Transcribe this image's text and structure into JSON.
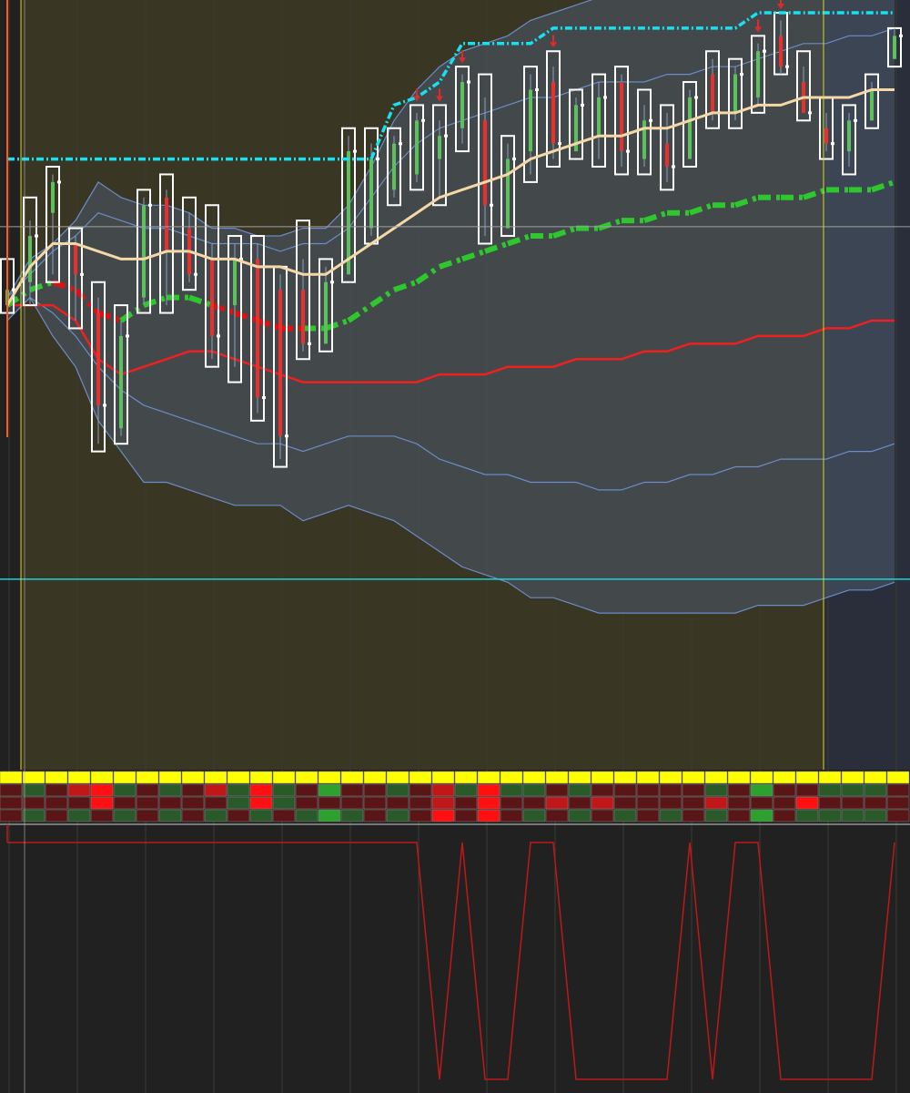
{
  "colors": {
    "background": "#212121",
    "session_shade": "#3a3624",
    "future_shade": "#2a2e3a",
    "band_fill": "#4a5a6a",
    "band_line": "#6a8cc8",
    "candle_up": "#5cc05c",
    "candle_down": "#e83030",
    "range_box": "#ffffff",
    "cyan": "#19e0f0",
    "tan": "#f5d8a8",
    "trend_green": "#2ec82e",
    "trend_red": "#e01010",
    "red_line": "#ee2020",
    "session_line": "#d8d820",
    "orange_line": "#ff5a1a",
    "price_line": "#a0a0a0",
    "support_line": "#20d0d8",
    "arrow": "#e02a2a",
    "osc_line": "#c01818",
    "heat_yellow": "#ffff00",
    "heat_bright_red": "#ff1010",
    "heat_red": "#c01818",
    "heat_dark_red": "#5a1616",
    "heat_green": "#2a5a2a",
    "heat_bright_green": "#2ea02e"
  },
  "chart_data": {
    "type": "candlestick",
    "title": "",
    "xlabel": "",
    "ylabel": "",
    "ylim": [
      0,
      100
    ],
    "grid": true,
    "bars_total": 40,
    "current_price": 72.2,
    "support_level": 26.4,
    "candles": [
      {
        "box": [
          61,
          68
        ],
        "o": 62,
        "c": 64,
        "h": 66,
        "l": 61
      },
      {
        "box": [
          62,
          76
        ],
        "o": 65,
        "c": 71,
        "h": 73,
        "l": 62
      },
      {
        "box": [
          65,
          80
        ],
        "o": 74,
        "c": 78,
        "h": 79,
        "l": 66
      },
      {
        "box": [
          59,
          72
        ],
        "o": 70,
        "c": 66,
        "h": 71,
        "l": 60
      },
      {
        "box": [
          43,
          65
        ],
        "o": 61,
        "c": 49,
        "h": 63,
        "l": 44
      },
      {
        "box": [
          44,
          62
        ],
        "o": 46,
        "c": 58,
        "h": 60,
        "l": 45
      },
      {
        "box": [
          61,
          77
        ],
        "o": 63,
        "c": 75,
        "h": 76,
        "l": 62
      },
      {
        "box": [
          61,
          79
        ],
        "o": 76,
        "c": 69,
        "h": 77,
        "l": 62
      },
      {
        "box": [
          64,
          76
        ],
        "o": 72,
        "c": 66,
        "h": 74,
        "l": 65
      },
      {
        "box": [
          54,
          75
        ],
        "o": 68,
        "c": 58,
        "h": 70,
        "l": 55
      },
      {
        "box": [
          52,
          71
        ],
        "o": 62,
        "c": 68,
        "h": 70,
        "l": 54
      },
      {
        "box": [
          47,
          71
        ],
        "o": 68,
        "c": 50,
        "h": 70,
        "l": 48
      },
      {
        "box": [
          41,
          67
        ],
        "o": 64,
        "c": 45,
        "h": 66,
        "l": 42
      },
      {
        "box": [
          55,
          73
        ],
        "o": 64,
        "c": 57,
        "h": 68,
        "l": 56
      },
      {
        "box": [
          56,
          68
        ],
        "o": 57,
        "c": 65,
        "h": 67,
        "l": 57
      },
      {
        "box": [
          65,
          85
        ],
        "o": 66,
        "c": 82,
        "h": 84,
        "l": 66
      },
      {
        "box": [
          70,
          85
        ],
        "o": 72,
        "c": 81,
        "h": 83,
        "l": 71
      },
      {
        "box": [
          75,
          85
        ],
        "o": 77,
        "c": 83,
        "h": 84,
        "l": 76
      },
      {
        "box": [
          77,
          88
        ],
        "o": 79,
        "c": 86,
        "h": 87,
        "l": 78
      },
      {
        "box": [
          75,
          88
        ],
        "o": 81,
        "c": 84,
        "h": 86,
        "l": 76
      },
      {
        "box": [
          82,
          93
        ],
        "o": 85,
        "c": 91,
        "h": 92,
        "l": 83
      },
      {
        "box": [
          70,
          92
        ],
        "o": 86,
        "c": 75,
        "h": 89,
        "l": 71
      },
      {
        "box": [
          71,
          84
        ],
        "o": 72,
        "c": 81,
        "h": 83,
        "l": 72
      },
      {
        "box": [
          78,
          93
        ],
        "o": 82,
        "c": 90,
        "h": 92,
        "l": 79
      },
      {
        "box": [
          80,
          95
        ],
        "o": 91,
        "c": 83,
        "h": 93,
        "l": 81
      },
      {
        "box": [
          81,
          90
        ],
        "o": 82,
        "c": 88,
        "h": 89,
        "l": 82
      },
      {
        "box": [
          80,
          92
        ],
        "o": 84,
        "c": 89,
        "h": 91,
        "l": 81
      },
      {
        "box": [
          79,
          93
        ],
        "o": 91,
        "c": 82,
        "h": 92,
        "l": 80
      },
      {
        "box": [
          79,
          90
        ],
        "o": 81,
        "c": 86,
        "h": 88,
        "l": 80
      },
      {
        "box": [
          77,
          88
        ],
        "o": 83,
        "c": 80,
        "h": 87,
        "l": 78
      },
      {
        "box": [
          80,
          91
        ],
        "o": 81,
        "c": 89,
        "h": 90,
        "l": 81
      },
      {
        "box": [
          85,
          95
        ],
        "o": 92,
        "c": 87,
        "h": 94,
        "l": 86
      },
      {
        "box": [
          85,
          94
        ],
        "o": 87,
        "c": 92,
        "h": 93,
        "l": 86
      },
      {
        "box": [
          87,
          97
        ],
        "o": 89,
        "c": 95,
        "h": 96,
        "l": 88
      },
      {
        "box": [
          92,
          100
        ],
        "o": 97,
        "c": 93,
        "h": 99,
        "l": 92
      },
      {
        "box": [
          86,
          95
        ],
        "o": 91,
        "c": 87,
        "h": 93,
        "l": 87
      },
      {
        "box": [
          81,
          89
        ],
        "o": 85,
        "c": 83,
        "h": 87,
        "l": 82
      },
      {
        "box": [
          79,
          88
        ],
        "o": 82,
        "c": 86,
        "h": 87,
        "l": 80
      },
      {
        "box": [
          85,
          92
        ],
        "o": 86,
        "c": 90,
        "h": 91,
        "l": 86
      },
      {
        "box": [
          93,
          98
        ],
        "o": 94,
        "c": 97,
        "h": 98,
        "l": 94
      }
    ],
    "series": [
      {
        "key": "band_upper",
        "values": [
          63,
          68,
          70,
          73,
          78,
          76,
          75,
          75,
          74,
          72,
          72,
          71,
          71,
          72,
          72,
          75,
          80,
          86,
          90,
          93,
          95,
          96,
          97,
          99,
          100,
          101,
          102,
          103,
          103,
          104,
          104,
          105,
          105,
          106,
          106,
          107,
          107,
          108,
          108,
          108
        ]
      },
      {
        "key": "band_lower",
        "values": [
          60,
          63,
          58,
          54,
          47,
          43,
          39,
          39,
          38,
          37,
          36,
          36,
          36,
          34,
          35,
          36,
          35,
          34,
          32,
          30,
          28,
          27,
          26,
          24,
          24,
          23,
          22,
          22,
          22,
          22,
          22,
          22,
          22,
          23,
          23,
          23,
          24,
          25,
          25,
          26
        ]
      },
      {
        "key": "band_upper_inner",
        "values": [
          63,
          66,
          69,
          71,
          74,
          73,
          72,
          72,
          71,
          70,
          70,
          70,
          69,
          70,
          70,
          72,
          76,
          80,
          83,
          85,
          86,
          87,
          88,
          89,
          89,
          90,
          91,
          91,
          91,
          92,
          92,
          93,
          93,
          94,
          95,
          96,
          96,
          97,
          97,
          98
        ]
      },
      {
        "key": "band_lower_inner",
        "values": [
          60,
          63,
          61,
          58,
          54,
          51,
          49,
          48,
          47,
          46,
          45,
          44,
          44,
          43,
          44,
          45,
          45,
          45,
          44,
          42,
          41,
          40,
          40,
          39,
          39,
          39,
          38,
          38,
          39,
          39,
          40,
          40,
          41,
          41,
          42,
          42,
          42,
          43,
          43,
          44
        ]
      },
      {
        "key": "moving_avg_tan",
        "values": [
          62,
          67,
          70,
          70,
          69,
          68,
          68,
          69,
          69,
          68,
          68,
          67,
          67,
          66,
          66,
          68,
          70,
          72,
          74,
          76,
          77,
          78,
          79,
          81,
          82,
          83,
          84,
          84,
          85,
          85,
          86,
          87,
          87,
          88,
          88,
          89,
          89,
          89,
          90,
          90
        ]
      },
      {
        "key": "moving_avg_red",
        "values": [
          62,
          62,
          62,
          60,
          55,
          53,
          54,
          55,
          56,
          56,
          55,
          54,
          53,
          52,
          52,
          52,
          52,
          52,
          52,
          53,
          53,
          53,
          54,
          54,
          54,
          55,
          55,
          55,
          56,
          56,
          57,
          57,
          57,
          58,
          58,
          58,
          59,
          59,
          60,
          60
        ]
      },
      {
        "key": "trailing_stop_cyan",
        "values": [
          81,
          81,
          81,
          81,
          81,
          81,
          81,
          81,
          81,
          81,
          81,
          81,
          81,
          81,
          81,
          81,
          81,
          88,
          89,
          91,
          96,
          96,
          96,
          96,
          98,
          98,
          98,
          98,
          98,
          98,
          98,
          98,
          98,
          100,
          100,
          100,
          100,
          100,
          100,
          100
        ]
      },
      {
        "key": "trend_ma",
        "values": [
          62,
          64,
          65,
          64,
          61,
          60,
          62,
          63,
          63,
          62,
          61,
          60,
          59,
          59,
          59,
          60,
          62,
          64,
          65,
          67,
          68,
          69,
          70,
          71,
          71,
          72,
          72,
          73,
          73,
          74,
          74,
          75,
          75,
          76,
          76,
          76,
          77,
          77,
          77,
          78
        ],
        "colors": [
          "g",
          "g",
          "r",
          "r",
          "r",
          "g",
          "g",
          "g",
          "g",
          "r",
          "r",
          "r",
          "r",
          "g",
          "g",
          "g",
          "g",
          "g",
          "g",
          "g",
          "g",
          "g",
          "g",
          "g",
          "g",
          "g",
          "g",
          "g",
          "g",
          "g",
          "g",
          "g",
          "g",
          "g",
          "g",
          "g",
          "g",
          "g",
          "g",
          "g"
        ]
      }
    ],
    "sell_arrows": [
      18,
      19,
      20,
      24,
      33,
      34
    ],
    "session_start_bar": 1,
    "session_end_bar": 36,
    "heatmap": {
      "rows": [
        [
          "Y",
          "Y",
          "Y",
          "Y",
          "Y",
          "Y",
          "Y",
          "Y",
          "Y",
          "Y",
          "Y",
          "Y",
          "Y",
          "Y",
          "Y",
          "Y",
          "Y",
          "Y",
          "Y",
          "Y",
          "Y",
          "Y",
          "Y",
          "Y",
          "Y",
          "Y",
          "Y",
          "Y",
          "Y",
          "Y",
          "Y",
          "Y",
          "Y",
          "Y",
          "Y",
          "Y",
          "Y",
          "Y",
          "Y",
          "Y"
        ],
        [
          "D",
          "G",
          "D",
          "R",
          "B",
          "G",
          "D",
          "G",
          "D",
          "R",
          "G",
          "B",
          "G",
          "D",
          "BG",
          "D",
          "D",
          "G",
          "D",
          "R",
          "G",
          "B",
          "G",
          "G",
          "D",
          "G",
          "D",
          "D",
          "D",
          "D",
          "D",
          "G",
          "D",
          "BG",
          "D",
          "D",
          "G",
          "G",
          "G",
          "D"
        ],
        [
          "D",
          "D",
          "D",
          "D",
          "B",
          "D",
          "D",
          "D",
          "D",
          "D",
          "G",
          "B",
          "G",
          "D",
          "D",
          "D",
          "D",
          "D",
          "D",
          "R",
          "D",
          "B",
          "D",
          "D",
          "R",
          "D",
          "R",
          "D",
          "D",
          "D",
          "D",
          "R",
          "D",
          "D",
          "D",
          "B",
          "D",
          "D",
          "D",
          "D"
        ],
        [
          "D",
          "G",
          "D",
          "G",
          "D",
          "G",
          "D",
          "G",
          "D",
          "G",
          "D",
          "G",
          "D",
          "G",
          "BG",
          "G",
          "D",
          "G",
          "D",
          "B",
          "D",
          "B",
          "D",
          "G",
          "D",
          "G",
          "D",
          "G",
          "D",
          "G",
          "D",
          "G",
          "D",
          "BG",
          "D",
          "G",
          "G",
          "G",
          "G",
          "D"
        ]
      ]
    },
    "oscillator": {
      "ylim": [
        0,
        1
      ],
      "values": [
        1,
        1,
        1,
        1,
        1,
        1,
        1,
        1,
        1,
        1,
        1,
        1,
        1,
        1,
        1,
        1,
        1,
        1,
        1,
        0,
        1,
        0,
        0,
        1,
        1,
        0,
        0,
        0,
        0,
        0,
        1,
        0,
        1,
        1,
        0,
        0,
        0,
        0,
        0,
        1
      ]
    }
  }
}
